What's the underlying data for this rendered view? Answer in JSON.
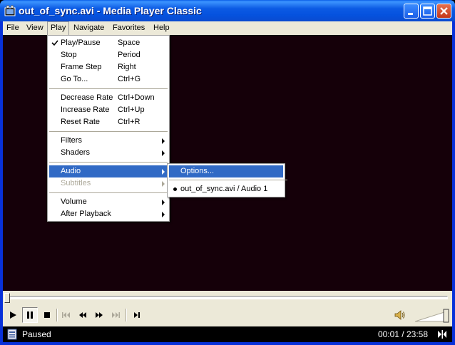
{
  "window": {
    "title": "out_of_sync.avi - Media Player Classic",
    "buttons": {
      "minimize": "minimize-icon",
      "maximize": "maximize-icon",
      "close": "close-icon"
    }
  },
  "menubar": {
    "items": [
      "File",
      "View",
      "Play",
      "Navigate",
      "Favorites",
      "Help"
    ],
    "open_item": "Play"
  },
  "play_menu": {
    "items": [
      {
        "label": "Play/Pause",
        "accel": "Space",
        "checked": true
      },
      {
        "label": "Stop",
        "accel": "Period"
      },
      {
        "label": "Frame Step",
        "accel": "Right"
      },
      {
        "label": "Go To...",
        "accel": "Ctrl+G"
      },
      {
        "label": "Decrease Rate",
        "accel": "Ctrl+Down"
      },
      {
        "label": "Increase Rate",
        "accel": "Ctrl+Up"
      },
      {
        "label": "Reset Rate",
        "accel": "Ctrl+R"
      },
      {
        "label": "Filters",
        "submenu": true
      },
      {
        "label": "Shaders",
        "submenu": true
      },
      {
        "label": "Audio",
        "submenu": true,
        "highlighted": true
      },
      {
        "label": "Subtitles",
        "submenu": true,
        "disabled": true
      },
      {
        "label": "Volume",
        "submenu": true
      },
      {
        "label": "After Playback",
        "submenu": true
      }
    ]
  },
  "audio_menu": {
    "items": [
      {
        "label": "Options...",
        "highlighted": true
      },
      {
        "label": "out_of_sync.avi / Audio 1",
        "selected": true
      }
    ]
  },
  "controls": {
    "buttons": [
      "play-icon",
      "pause-icon",
      "stop-icon",
      "skip-back-icon",
      "rewind-icon",
      "fast-forward-icon",
      "skip-forward-icon",
      "frame-step-icon"
    ],
    "pressed": "pause-icon",
    "seek_position": 0.0,
    "volume_level": 1.0
  },
  "status": {
    "text": "Paused",
    "time": "00:01 / 23:58"
  },
  "colors": {
    "menu_highlight": "#316ac5",
    "video_bg": "#150009",
    "chrome": "#ece9d8"
  }
}
